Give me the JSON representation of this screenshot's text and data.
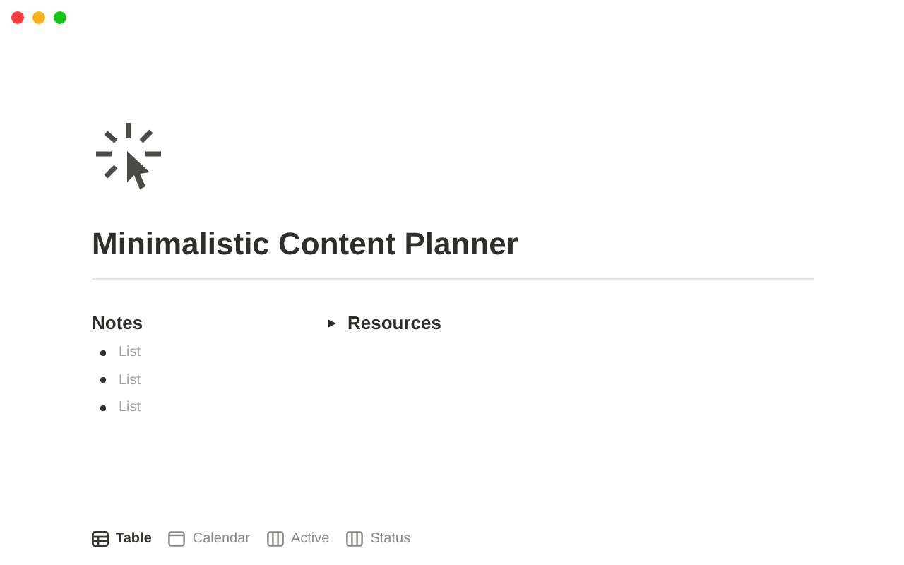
{
  "page": {
    "title": "Minimalistic Content Planner"
  },
  "notes": {
    "heading": "Notes",
    "items": [
      {
        "text": "List"
      },
      {
        "text": "List"
      },
      {
        "text": "List"
      }
    ]
  },
  "toggle": {
    "label": "Resources",
    "expanded": false
  },
  "views": [
    {
      "label": "Table",
      "kind": "table",
      "selected": true
    },
    {
      "label": "Calendar",
      "kind": "calendar",
      "selected": false
    },
    {
      "label": "Active",
      "kind": "board",
      "selected": false
    },
    {
      "label": "Status",
      "kind": "board",
      "selected": false
    }
  ]
}
